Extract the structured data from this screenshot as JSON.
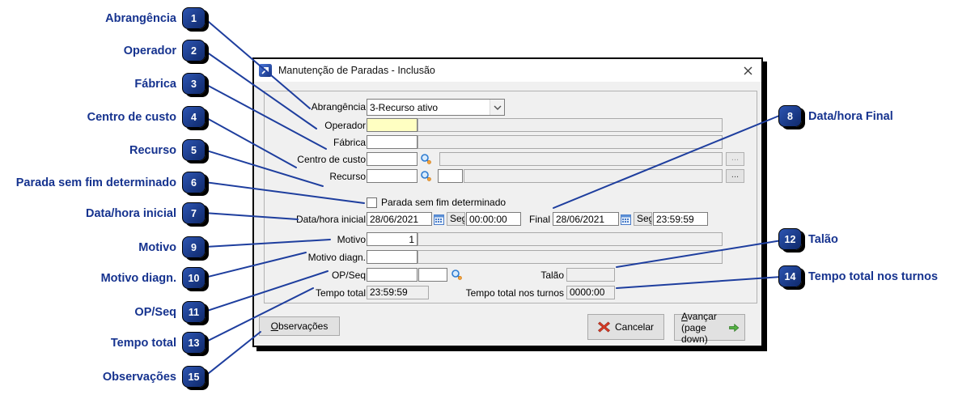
{
  "window": {
    "title": "Manutenção de Paradas - Inclusão"
  },
  "dialog": {
    "abrangencia": {
      "label": "Abrangência",
      "value": "3-Recurso ativo"
    },
    "operador": {
      "label": "Operador",
      "value": "",
      "desc": ""
    },
    "fabrica": {
      "label": "Fábrica",
      "value": "",
      "desc": ""
    },
    "centro_de_custo": {
      "label": "Centro de custo",
      "value": "",
      "desc": ""
    },
    "recurso": {
      "label": "Recurso",
      "value": "",
      "code": "",
      "desc": ""
    },
    "parada_sem_fim": {
      "label": "Parada sem fim determinado",
      "checked": false
    },
    "data_hora_inicial": {
      "label": "Data/hora inicial",
      "date": "28/06/2021",
      "weekday": "Seg",
      "time": "00:00:00"
    },
    "data_hora_final": {
      "label": "Final",
      "date": "28/06/2021",
      "weekday": "Seg",
      "time": "23:59:59"
    },
    "motivo": {
      "label": "Motivo",
      "value": "1",
      "desc": ""
    },
    "motivo_diagn": {
      "label": "Motivo diagn.",
      "value": "",
      "desc": ""
    },
    "op_seq": {
      "label": "OP/Seq",
      "op": "",
      "seq": ""
    },
    "talao": {
      "label": "Talão",
      "value": ""
    },
    "tempo_total": {
      "label": "Tempo total",
      "value": "23:59:59"
    },
    "tempo_total_turnos": {
      "label": "Tempo total nos turnos",
      "value": "0000:00"
    },
    "buttons": {
      "observacoes": {
        "underline": "O",
        "rest": "bservações"
      },
      "cancelar": "Cancelar",
      "avancar": {
        "underline": "A",
        "rest": "vançar",
        "line2": "(page down)"
      }
    },
    "ellipsis": "..."
  },
  "annotations": {
    "left": [
      {
        "num": "1",
        "label": "Abrangência"
      },
      {
        "num": "2",
        "label": "Operador"
      },
      {
        "num": "3",
        "label": "Fábrica"
      },
      {
        "num": "4",
        "label": "Centro de custo"
      },
      {
        "num": "5",
        "label": "Recurso"
      },
      {
        "num": "6",
        "label": "Parada sem fim determinado"
      },
      {
        "num": "7",
        "label": "Data/hora inicial"
      },
      {
        "num": "9",
        "label": "Motivo"
      },
      {
        "num": "10",
        "label": "Motivo diagn."
      },
      {
        "num": "11",
        "label": "OP/Seq"
      },
      {
        "num": "13",
        "label": "Tempo total"
      },
      {
        "num": "15",
        "label": "Observações"
      }
    ],
    "right": [
      {
        "num": "8",
        "label": "Data/hora Final"
      },
      {
        "num": "12",
        "label": "Talão"
      },
      {
        "num": "14",
        "label": "Tempo total nos turnos"
      }
    ]
  },
  "colors": {
    "annotation_navy": "#16338f",
    "connector_blue": "#1e3e9e",
    "field_yellow": "#ffffc2",
    "dialog_bg": "#f0f0f0",
    "cancel_red": "#dd3c27",
    "advance_green": "#55b144"
  }
}
